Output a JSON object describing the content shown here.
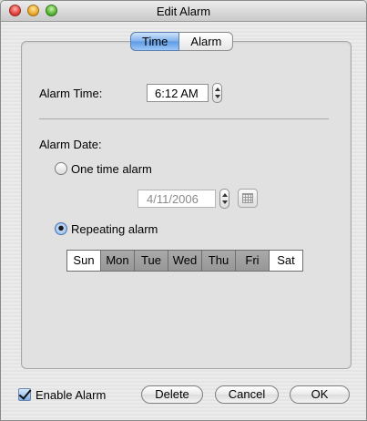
{
  "window": {
    "title": "Edit Alarm"
  },
  "tabs": [
    {
      "label": "Time",
      "selected": true
    },
    {
      "label": "Alarm",
      "selected": false
    }
  ],
  "alarm_time": {
    "label": "Alarm Time:",
    "value": "6:12 AM"
  },
  "alarm_date": {
    "label": "Alarm Date:",
    "one_time_label": "One time alarm",
    "one_time_selected": false,
    "date_value": "4/11/2006",
    "repeating_label": "Repeating alarm",
    "repeating_selected": true
  },
  "days": [
    {
      "label": "Sun",
      "selected": false
    },
    {
      "label": "Mon",
      "selected": true
    },
    {
      "label": "Tue",
      "selected": true
    },
    {
      "label": "Wed",
      "selected": true
    },
    {
      "label": "Thu",
      "selected": true
    },
    {
      "label": "Fri",
      "selected": true
    },
    {
      "label": "Sat",
      "selected": false
    }
  ],
  "footer": {
    "enable_label": "Enable Alarm",
    "enable_checked": true,
    "delete_label": "Delete",
    "cancel_label": "Cancel",
    "ok_label": "OK"
  }
}
